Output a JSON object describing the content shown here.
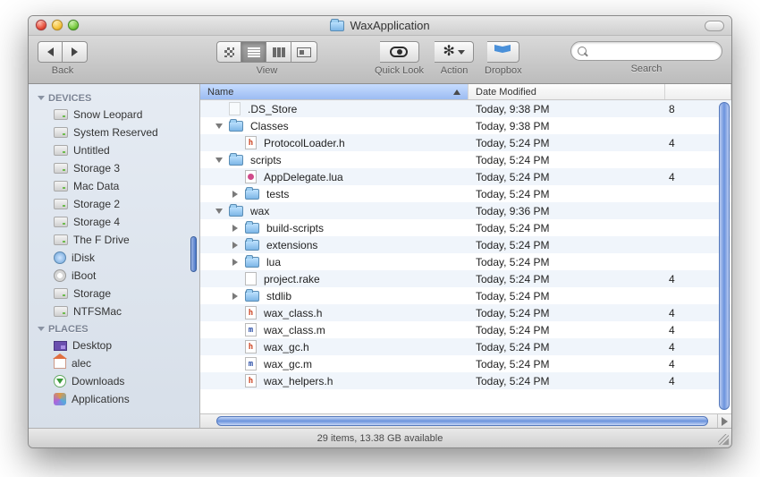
{
  "window": {
    "title": "WaxApplication"
  },
  "toolbar": {
    "back_label": "Back",
    "view_label": "View",
    "quicklook_label": "Quick Look",
    "action_label": "Action",
    "dropbox_label": "Dropbox",
    "search_label": "Search",
    "search_placeholder": ""
  },
  "sidebar": {
    "sections": [
      {
        "label": "DEVICES",
        "items": [
          {
            "label": "Snow Leopard",
            "icon": "drive"
          },
          {
            "label": "System Reserved",
            "icon": "drive"
          },
          {
            "label": "Untitled",
            "icon": "drive"
          },
          {
            "label": "Storage 3",
            "icon": "drive"
          },
          {
            "label": "Mac Data",
            "icon": "drive"
          },
          {
            "label": "Storage 2",
            "icon": "drive"
          },
          {
            "label": "Storage 4",
            "icon": "drive"
          },
          {
            "label": "The F Drive",
            "icon": "drive"
          },
          {
            "label": "iDisk",
            "icon": "idisk"
          },
          {
            "label": "iBoot",
            "icon": "cd"
          },
          {
            "label": "Storage",
            "icon": "drive"
          },
          {
            "label": "NTFSMac",
            "icon": "drive"
          }
        ]
      },
      {
        "label": "PLACES",
        "items": [
          {
            "label": "Desktop",
            "icon": "desk"
          },
          {
            "label": "alec",
            "icon": "house"
          },
          {
            "label": "Downloads",
            "icon": "dl"
          },
          {
            "label": "Applications",
            "icon": "app"
          }
        ]
      }
    ]
  },
  "columns": {
    "name": "Name",
    "date": "Date Modified"
  },
  "rows": [
    {
      "depth": 0,
      "name": ".DS_Store",
      "kind": "doc-dim",
      "arrow": "none",
      "date": "Today, 9:38 PM",
      "extra": "8"
    },
    {
      "depth": 0,
      "name": "Classes",
      "kind": "folder",
      "arrow": "open",
      "date": "Today, 9:38 PM",
      "extra": ""
    },
    {
      "depth": 1,
      "name": "ProtocolLoader.h",
      "kind": "h",
      "arrow": "none",
      "date": "Today, 5:24 PM",
      "extra": "4"
    },
    {
      "depth": 0,
      "name": "scripts",
      "kind": "folder",
      "arrow": "open",
      "date": "Today, 5:24 PM",
      "extra": ""
    },
    {
      "depth": 1,
      "name": "AppDelegate.lua",
      "kind": "lua",
      "arrow": "none",
      "date": "Today, 5:24 PM",
      "extra": "4"
    },
    {
      "depth": 1,
      "name": "tests",
      "kind": "folder",
      "arrow": "closed",
      "date": "Today, 5:24 PM",
      "extra": ""
    },
    {
      "depth": 0,
      "name": "wax",
      "kind": "folder",
      "arrow": "open",
      "date": "Today, 9:36 PM",
      "extra": ""
    },
    {
      "depth": 1,
      "name": "build-scripts",
      "kind": "folder",
      "arrow": "closed",
      "date": "Today, 5:24 PM",
      "extra": ""
    },
    {
      "depth": 1,
      "name": "extensions",
      "kind": "folder",
      "arrow": "closed",
      "date": "Today, 5:24 PM",
      "extra": ""
    },
    {
      "depth": 1,
      "name": "lua",
      "kind": "folder",
      "arrow": "closed",
      "date": "Today, 5:24 PM",
      "extra": ""
    },
    {
      "depth": 1,
      "name": "project.rake",
      "kind": "doc",
      "arrow": "none",
      "date": "Today, 5:24 PM",
      "extra": "4"
    },
    {
      "depth": 1,
      "name": "stdlib",
      "kind": "folder",
      "arrow": "closed",
      "date": "Today, 5:24 PM",
      "extra": ""
    },
    {
      "depth": 1,
      "name": "wax_class.h",
      "kind": "h",
      "arrow": "none",
      "date": "Today, 5:24 PM",
      "extra": "4"
    },
    {
      "depth": 1,
      "name": "wax_class.m",
      "kind": "m",
      "arrow": "none",
      "date": "Today, 5:24 PM",
      "extra": "4"
    },
    {
      "depth": 1,
      "name": "wax_gc.h",
      "kind": "h",
      "arrow": "none",
      "date": "Today, 5:24 PM",
      "extra": "4"
    },
    {
      "depth": 1,
      "name": "wax_gc.m",
      "kind": "m",
      "arrow": "none",
      "date": "Today, 5:24 PM",
      "extra": "4"
    },
    {
      "depth": 1,
      "name": "wax_helpers.h",
      "kind": "h",
      "arrow": "none",
      "date": "Today, 5:24 PM",
      "extra": "4"
    }
  ],
  "status": "29 items, 13.38 GB available"
}
